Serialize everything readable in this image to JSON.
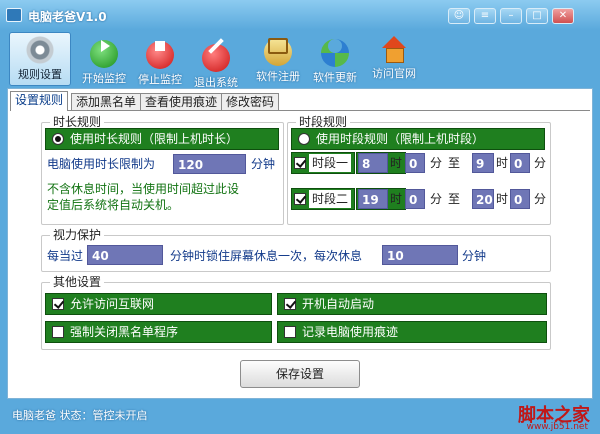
{
  "window": {
    "title": "电脑老爸V1.0"
  },
  "toolbar": [
    {
      "label": "规则设置",
      "icon": "gear-icon"
    },
    {
      "label": "开始监控",
      "icon": "play-icon"
    },
    {
      "label": "停止监控",
      "icon": "stop-icon"
    },
    {
      "label": "退出系统",
      "icon": "ban-icon"
    },
    {
      "label": "软件注册",
      "icon": "register-icon"
    },
    {
      "label": "软件更新",
      "icon": "update-icon"
    },
    {
      "label": "访问官网",
      "icon": "home-icon"
    }
  ],
  "tabs": [
    "设置规则",
    "添加黑名单",
    "查看使用痕迹",
    "修改密码"
  ],
  "duration": {
    "legend": "时长规则",
    "radio_label": "使用时长规则（限制上机时长）",
    "limit_label": "电脑使用时长限制为",
    "limit_value": "120",
    "limit_unit": "分钟",
    "note_line1": "不含休息时间，当使用时间超过此设",
    "note_line2": "定值后系统将自动关机。"
  },
  "period": {
    "legend": "时段规则",
    "radio_label": "使用时段规则（限制上机时段）",
    "rows": [
      {
        "label": "时段一",
        "start_h": "8",
        "start_m": "0",
        "end_h": "9",
        "end_m": "0"
      },
      {
        "label": "时段二",
        "start_h": "19",
        "start_m": "0",
        "end_h": "20",
        "end_m": "0"
      }
    ],
    "unit_h": "时",
    "unit_m": "分",
    "to": "至"
  },
  "vision": {
    "legend": "视力保护",
    "prefix": "每当过",
    "interval": "40",
    "middle": "分钟时锁住屏幕休息一次，每次休息",
    "rest": "10",
    "unit": "分钟"
  },
  "other": {
    "legend": "其他设置",
    "options": [
      {
        "label": "允许访问互联网",
        "checked": true
      },
      {
        "label": "开机自动启动",
        "checked": true
      },
      {
        "label": "强制关闭黑名单程序",
        "checked": false
      },
      {
        "label": "记录电脑使用痕迹",
        "checked": false
      }
    ]
  },
  "save_label": "保存设置",
  "status": "电脑老爸 状态：管控未开启",
  "watermark": {
    "main": "脚本之家",
    "sub": "www.jb51.net"
  }
}
